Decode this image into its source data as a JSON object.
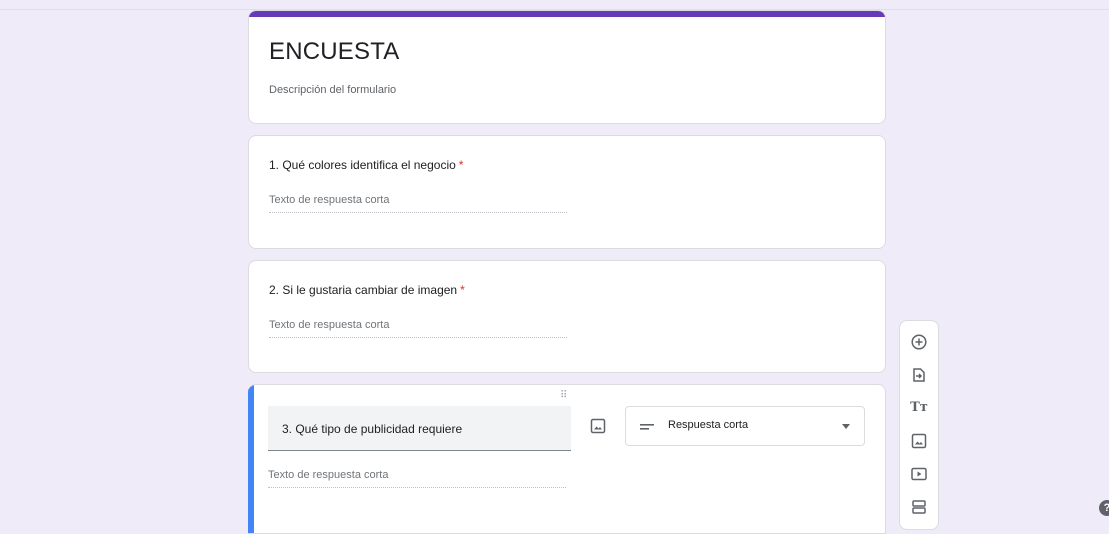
{
  "form": {
    "title": "ENCUESTA",
    "description": "Descripción del formulario",
    "accent_color": "#673ab7",
    "background_color": "#f0ebf8"
  },
  "questions": [
    {
      "number_title": "1.  Qué colores identifica el negocio",
      "required_mark": "*",
      "answer_placeholder": "Texto de respuesta corta"
    },
    {
      "number_title": "2. Si le gustaria cambiar de imagen",
      "required_mark": "*",
      "answer_placeholder": "Texto de respuesta corta"
    },
    {
      "number_title": "3. Qué tipo de publicidad requiere",
      "answer_placeholder": "Texto de respuesta corta",
      "type_label": "Respuesta corta",
      "active": true,
      "active_color": "#4285f4"
    }
  ],
  "drag_handle_glyph": "⠿",
  "toolbar": {
    "items": [
      "add-question-icon",
      "import-questions-icon",
      "add-title-icon",
      "add-image-icon",
      "add-video-icon",
      "add-section-icon"
    ],
    "title_glyph": "Tт"
  },
  "help": {
    "glyph": "?"
  }
}
